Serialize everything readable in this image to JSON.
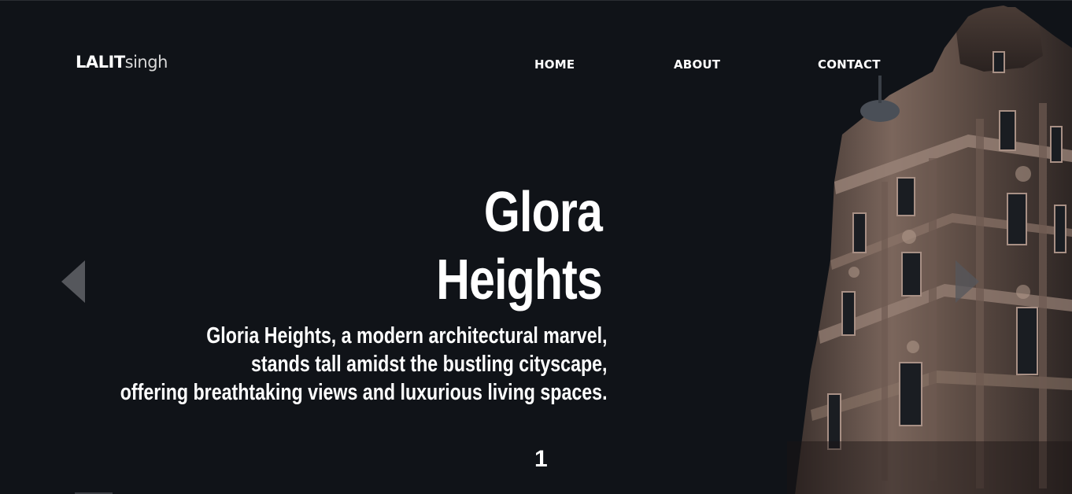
{
  "header": {
    "logo_bold": "LALIT",
    "logo_light": "singh",
    "nav": {
      "home": "HOME",
      "about": "ABOUT",
      "contact": "CONTACT"
    }
  },
  "hero": {
    "title_line1": "Glora",
    "title_line2": "Heights",
    "description_line1": "Gloria Heights, a modern architectural marvel,",
    "description_line2": "stands tall amidst the bustling cityscape,",
    "description_line3": "offering breathtaking views and luxurious living spaces.",
    "slide_number": "1"
  },
  "carousel": {
    "prev_icon": "triangle-left-icon",
    "next_icon": "triangle-right-icon"
  },
  "colors": {
    "background": "#101318",
    "text": "#ffffff",
    "arrow": "#55575c",
    "building_stone": "#8a7468"
  }
}
